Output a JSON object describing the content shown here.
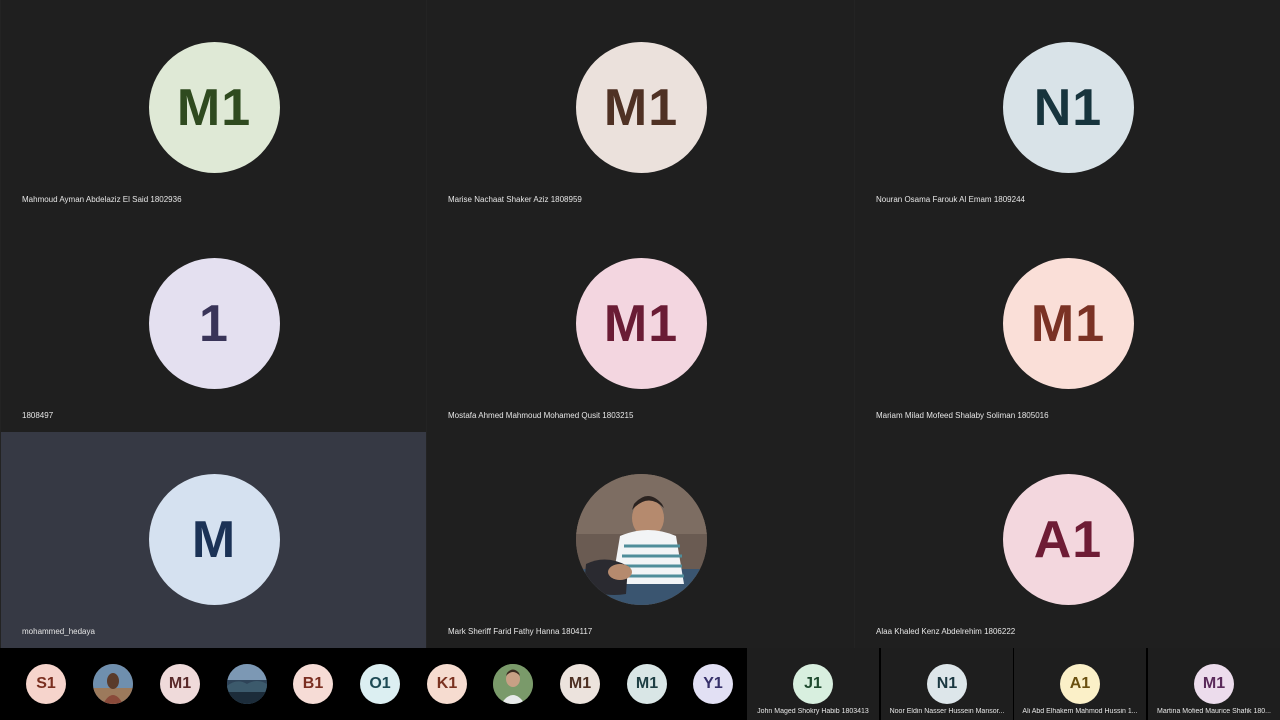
{
  "grid": [
    {
      "initials": "M1",
      "name": "Mahmoud Ayman Abdelaziz El Said 1802936",
      "bg": "#dfe9d6",
      "fg": "#2f4a1f"
    },
    {
      "initials": "M1",
      "name": "Marise Nachaat Shaker Aziz 1808959",
      "bg": "#ebe1dc",
      "fg": "#4f3124"
    },
    {
      "initials": "N1",
      "name": "Nouran Osama Farouk Al Emam 1809244",
      "bg": "#d9e3e8",
      "fg": "#17343d"
    },
    {
      "initials": "1",
      "name": "1808497",
      "bg": "#e4e0f0",
      "fg": "#393458"
    },
    {
      "initials": "M1",
      "name": "Mostafa Ahmed Mahmoud Mohamed Qusit 1803215",
      "bg": "#f3d6e0",
      "fg": "#6a1c35"
    },
    {
      "initials": "M1",
      "name": "Mariam Milad Mofeed Shalaby Soliman 1805016",
      "bg": "#fadfd8",
      "fg": "#7a3225"
    },
    {
      "initials": "M",
      "name": "mohammed_hedaya",
      "bg": "#d5e1f0",
      "fg": "#1b3256",
      "active": true
    },
    {
      "initials": "",
      "name": "Mark Sheriff Farid Fathy Hanna 1804117",
      "bg": "#6e6258",
      "fg": "#ffffff",
      "photo": true
    },
    {
      "initials": "A1",
      "name": "Alaa Khaled Kenz Abdelrehim 1806222",
      "bg": "#f3d7de",
      "fg": "#6e1c35"
    }
  ],
  "strip": [
    {
      "initials": "S1",
      "bg": "#f6d4cc",
      "fg": "#7a2f20"
    },
    {
      "initials": "",
      "bg": "#8a6a55",
      "fg": "#ffffff",
      "photo": "person"
    },
    {
      "initials": "M1",
      "bg": "#efdada",
      "fg": "#5a2a2a"
    },
    {
      "initials": "",
      "bg": "#4d6a86",
      "fg": "#ffffff",
      "photo": "landscape"
    },
    {
      "initials": "B1",
      "bg": "#f6dcd6",
      "fg": "#7a2e21"
    },
    {
      "initials": "O1",
      "bg": "#dceff2",
      "fg": "#1e4b55"
    },
    {
      "initials": "K1",
      "bg": "#f6dcd0",
      "fg": "#7a3220"
    },
    {
      "initials": "",
      "bg": "#6f8a5b",
      "fg": "#ffffff",
      "photo": "person2"
    },
    {
      "initials": "M1",
      "bg": "#ece3dd",
      "fg": "#4f3124"
    },
    {
      "initials": "M1",
      "bg": "#d9e6e6",
      "fg": "#1e3f44"
    },
    {
      "initials": "Y1",
      "bg": "#e2e0f4",
      "fg": "#36306a"
    }
  ],
  "named_strip": [
    {
      "initials": "J1",
      "name": "John Maged Shokry Habib 1803413",
      "bg": "#d8efdf",
      "fg": "#1e4a2e"
    },
    {
      "initials": "N1",
      "name": "Noor Eldin Nasser Hussein Mansor...",
      "bg": "#dde6ea",
      "fg": "#1a3740"
    },
    {
      "initials": "A1",
      "name": "Ali Abd Elhakem Mahmod Hussin 1...",
      "bg": "#fbf0c8",
      "fg": "#6a5010"
    },
    {
      "initials": "M1",
      "name": "Martina Mofied Maurice Shafik 180...",
      "bg": "#ecdcec",
      "fg": "#5a2a5a"
    }
  ]
}
